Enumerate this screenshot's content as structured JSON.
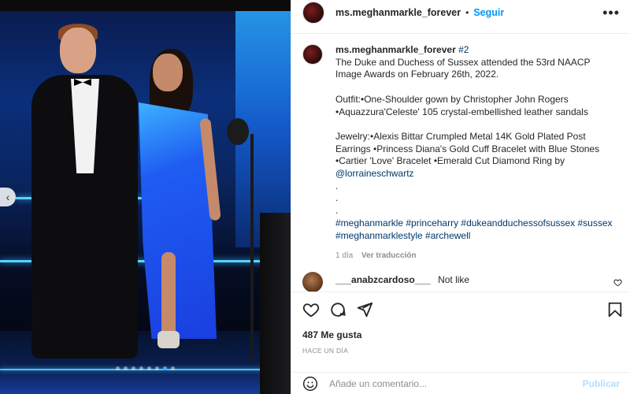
{
  "post": {
    "username": "ms.meghanmarkle_forever",
    "follow_label": "Seguir",
    "more_label": "•••",
    "prev_arrow": "‹",
    "carousel": {
      "count": 8,
      "active_index": 6
    }
  },
  "caption": {
    "username": "ms.meghanmarkle_forever",
    "inline_tag": "#2",
    "lines": [
      "The Duke and Duchess of Sussex attended the 53rd NAACP",
      "Image Awards on February 26th, 2022."
    ],
    "outfit_lines": [
      "Outfit:•One-Shoulder gown by Christopher John Rogers",
      "•Aquazzura'Celeste' 105 crystal-embellished leather sandals"
    ],
    "jewelry_lines": [
      "Jewelry:•Alexis Bittar Crumpled Metal 14K Gold Plated Post",
      "Earrings •Princess Diana's Gold Cuff Bracelet with Blue Stones",
      "•Cartier 'Love' Bracelet •Emerald Cut Diamond Ring by"
    ],
    "mention": "@lorraineschwartz",
    "dots": [
      ".",
      ".",
      "."
    ],
    "hashtags_line1": "#meghanmarkle #princeharry #dukeandduchessofsussex #sussex",
    "hashtags_line2": "#meghanmarklestyle #archewell",
    "time": "1 día",
    "translate_label": "Ver traducción"
  },
  "comment": {
    "username": "___anabzcardoso___",
    "text": "Not like",
    "like_icon": "heart-outline-icon"
  },
  "actions": {
    "icons": [
      "heart-outline-icon",
      "comment-icon",
      "share-icon",
      "bookmark-icon"
    ]
  },
  "likes_text": "487 Me gusta",
  "date_text": "HACE UN DÍA",
  "composer": {
    "placeholder": "Añade un comentario...",
    "publish_label": "Publicar",
    "emoji_icon": "smiley-icon"
  },
  "colors": {
    "link": "#00376b",
    "follow": "#0095f6",
    "publish_disabled": "#b2dffc",
    "gown": "#1f5df2"
  }
}
